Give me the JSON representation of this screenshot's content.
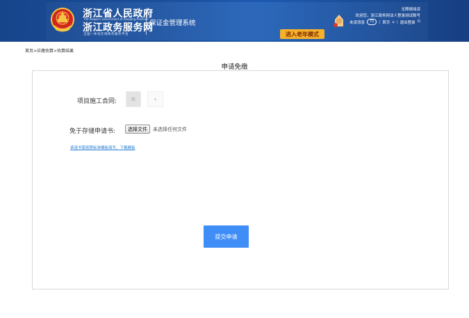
{
  "header": {
    "site_title_cn": "浙江省人民政府",
    "site_title_en": "The People's Government of Zhejiang Province",
    "site_subtitle_cn": "浙江政务服务网",
    "site_slogan": "全国一体化在线政务服务平台",
    "system_name": "保证金管理系统",
    "user_top": "无障碍阅读",
    "welcome": "欢迎您，浙江政务网法人登录测试账号",
    "unread_label": "未读消息",
    "unread_count": "71",
    "home_link": "首页",
    "logout_link": "退出登录",
    "elder_mode_button": "进入老年模式",
    "colors": {
      "header_bg": "#1a4f9c",
      "elder_button": "#f7b02a"
    }
  },
  "breadcrumb": "首页>应缴估算>估算结果",
  "page_title": "申请免缴",
  "form": {
    "contract_label": "项目施工合同:",
    "add_symbol": "+",
    "exempt_label": "免于存储申请书:",
    "file_button": "选择文件",
    "file_status": "未选择任何文件",
    "template_link": "承诺书需按照标准模板填写，下载模板",
    "submit_button": "提交申请",
    "colors": {
      "submit_bg": "#3f8ef7",
      "link": "#2a7fd4"
    }
  },
  "icons": [
    "national-emblem-icon",
    "mascot-icon",
    "home-icon",
    "logout-icon",
    "image-thumbnail-icon"
  ]
}
